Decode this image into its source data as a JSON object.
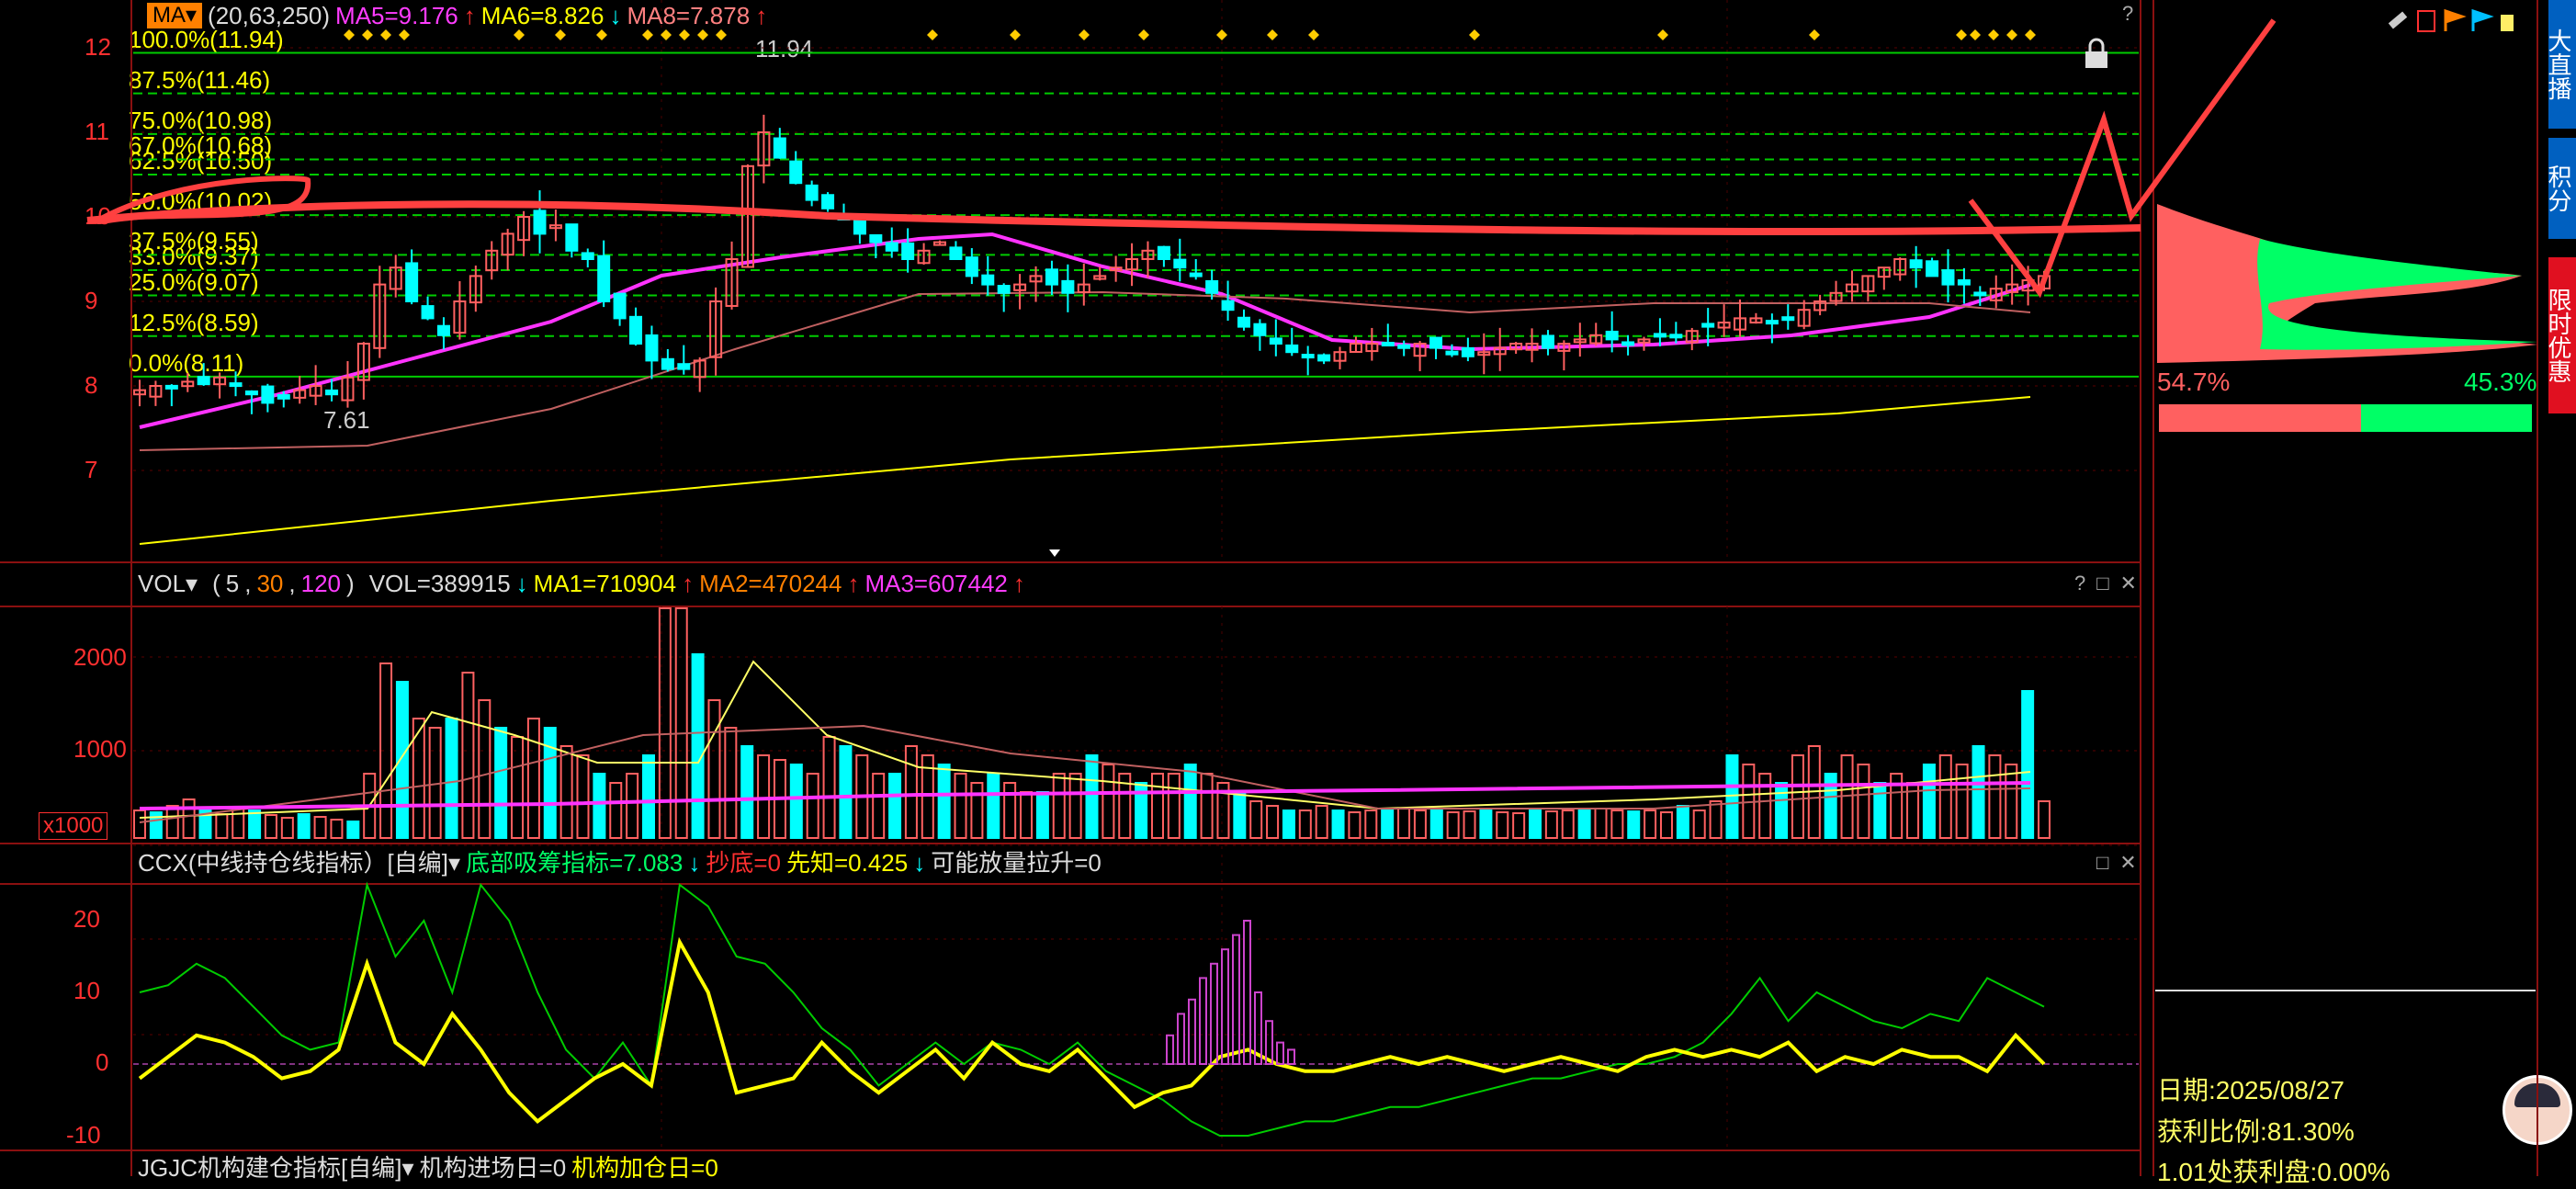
{
  "main_panel": {
    "indicator_button": "MA",
    "params": "(20,63,250)",
    "ma5": "MA5=9.176",
    "ma5_arrow": "↑",
    "ma6": "MA6=8.826",
    "ma6_arrow": "↓",
    "ma8": "MA8=7.878",
    "ma8_arrow": "↑",
    "help": "?",
    "high_label": "11.94",
    "low_label": "7.61",
    "y_ticks": [
      "12",
      "11",
      "10",
      "9",
      "8",
      "7"
    ],
    "fib_levels": [
      {
        "label": "100.0%(11.94)",
        "value": 11.94
      },
      {
        "label": "87.5%(11.46)",
        "value": 11.46
      },
      {
        "label": "75.0%(10.98)",
        "value": 10.98
      },
      {
        "label": "67.0%(10.68)",
        "value": 10.68
      },
      {
        "label": "62.5%(10.50)",
        "value": 10.5
      },
      {
        "label": "50.0%(10.02)",
        "value": 10.02
      },
      {
        "label": "37.5%(9.55)",
        "value": 9.55
      },
      {
        "label": "33.0%(9.37)",
        "value": 9.37
      },
      {
        "label": "25.0%(9.07)",
        "value": 9.07
      },
      {
        "label": "12.5%(8.59)",
        "value": 8.59
      },
      {
        "label": "0.0%(8.11)",
        "value": 8.11
      }
    ]
  },
  "vol_panel": {
    "indicator_button": "VOL",
    "params_open": "(",
    "p1": "5",
    "p2": "30",
    "p3": "120",
    "params_close": ")",
    "vol": "VOL=389915",
    "vol_arrow": "↓",
    "ma1": "MA1=710904",
    "ma1_arrow": "↑",
    "ma2": "MA2=470244",
    "ma2_arrow": "↑",
    "ma3": "MA3=607442",
    "ma3_arrow": "↑",
    "y_ticks": [
      "2000",
      "1000"
    ],
    "unit": "x1000",
    "ctrl_help": "?",
    "ctrl_max": "□",
    "ctrl_close": "✕"
  },
  "ccx_panel": {
    "title": "CCX(中线持仓线指标）[自编]",
    "l1": "底部吸筹指标=7.083",
    "l1_arrow": "↓",
    "l2": "抄底=0",
    "l3": "先知=0.425",
    "l3_arrow": "↓",
    "l4": "可能放量拉升=0",
    "y_ticks": [
      "20",
      "10",
      "0",
      "-10"
    ],
    "ctrl_max": "□",
    "ctrl_close": "✕"
  },
  "jgjc_panel": {
    "title": "JGJC机构建仓指标[自编]",
    "l1": "机构进场日=0",
    "l2": "机构加仓日=0"
  },
  "chip_panel": {
    "left_pct": "54.7%",
    "right_pct": "45.3%",
    "date_label": "日期:2025/08/27",
    "profit_label": "获利比例:81.30%",
    "profit_line": "1.01处获利盘:0.00%"
  },
  "side_tabs": [
    "大直播",
    "积分",
    "限时优惠"
  ],
  "colors": {
    "up": "#ff6060",
    "down": "#00ffff",
    "ma_mag": "#ff33ff",
    "ma_yel": "#ffff00",
    "ma_pink": "#c06060",
    "fib": "#00ff00",
    "chip_red": "#ff6060",
    "chip_green": "#00ff66"
  }
}
